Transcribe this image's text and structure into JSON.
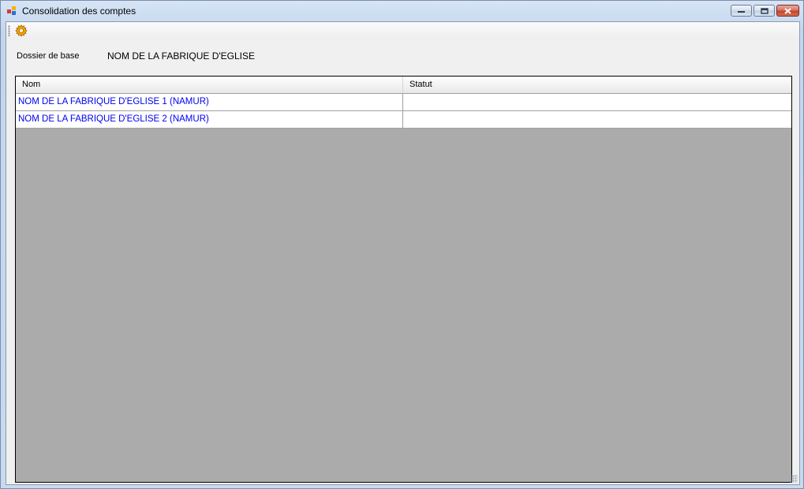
{
  "window": {
    "title": "Consolidation des comptes",
    "icon": "app-form-icon",
    "controls": {
      "minimize": "minimize-icon",
      "maximize": "restore-icon",
      "close": "close-icon"
    }
  },
  "toolbar": {
    "items": [
      {
        "icon": "gear-icon"
      }
    ]
  },
  "form": {
    "dossier_label": "Dossier de base",
    "dossier_value": "NOM DE LA FABRIQUE D'EGLISE"
  },
  "grid": {
    "columns": [
      "Nom",
      "Statut"
    ],
    "rows": [
      {
        "nom": "NOM DE LA FABRIQUE D'EGLISE 1 (NAMUR)",
        "statut": ""
      },
      {
        "nom": "NOM DE LA FABRIQUE D'EGLISE 2 (NAMUR)",
        "statut": ""
      }
    ]
  },
  "colors": {
    "link": "#0000ee",
    "grid_background": "#ababab",
    "close_button": "#c0432c"
  }
}
